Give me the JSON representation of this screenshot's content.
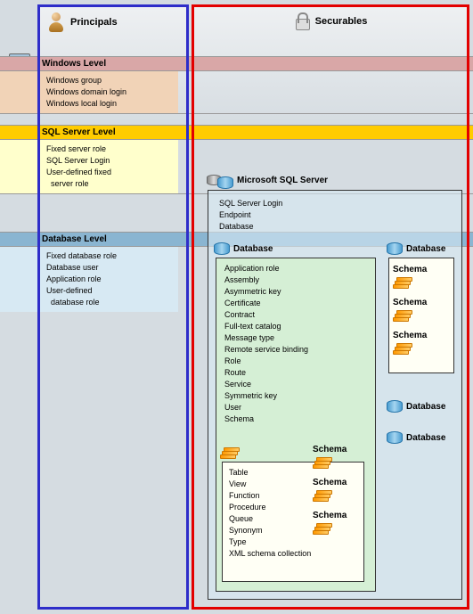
{
  "columns": {
    "principals": "Principals",
    "securables": "Securables"
  },
  "levels": {
    "windows": {
      "title": "Windows Level",
      "items": [
        "Windows group",
        "Windows domain login",
        "Windows local login"
      ]
    },
    "sql": {
      "title": "SQL Server Level",
      "items": [
        "Fixed server role",
        "SQL Server Login",
        "User-defined fixed",
        "  server role"
      ]
    },
    "database": {
      "title": "Database Level",
      "items": [
        "Fixed database role",
        "Database user",
        "Application role",
        "User-defined",
        "  database role"
      ]
    }
  },
  "securables": {
    "server": {
      "title": "Microsoft SQL Server",
      "items": [
        "SQL Server Login",
        "Endpoint",
        "Database"
      ]
    },
    "database": {
      "title": "Database",
      "items": [
        "Application role",
        "Assembly",
        "Asymmetric key",
        "Certificate",
        "Contract",
        "Full-text catalog",
        "Message type",
        "Remote service binding",
        "Role",
        "Route",
        "Service",
        "Symmetric key",
        "User",
        "Schema"
      ]
    },
    "schema": {
      "title": "Schema",
      "items": [
        "Table",
        "View",
        "Function",
        "Procedure",
        "Queue",
        "Synonym",
        "Type",
        "XML schema collection"
      ]
    },
    "extra_db": "Database",
    "extra_schema": "Schema"
  }
}
